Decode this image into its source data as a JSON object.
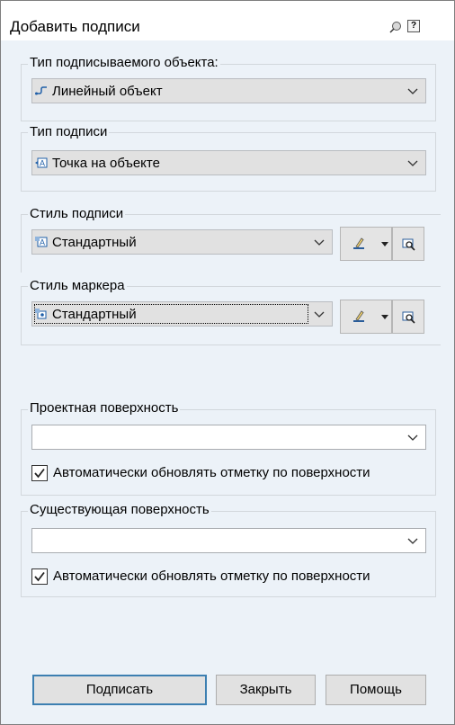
{
  "window": {
    "title": "Добавить подписи"
  },
  "object_type": {
    "label": "Тип подписываемого объекта:",
    "value": "Линейный объект"
  },
  "label_type": {
    "label": "Тип подписи",
    "value": "Точка на объекте"
  },
  "label_style": {
    "label": "Стиль подписи",
    "value": "Стандартный"
  },
  "marker_style": {
    "label": "Стиль маркера",
    "value": "Стандартный"
  },
  "design_surface": {
    "label": "Проектная поверхность",
    "value": "",
    "auto_update_label": "Автоматически обновлять отметку по поверхности",
    "auto_update_checked": true
  },
  "existing_surface": {
    "label": "Существующая поверхность",
    "value": "",
    "auto_update_label": "Автоматически обновлять отметку по поверхности",
    "auto_update_checked": true
  },
  "buttons": {
    "label": "Подписать",
    "close": "Закрыть",
    "help": "Помощь"
  }
}
